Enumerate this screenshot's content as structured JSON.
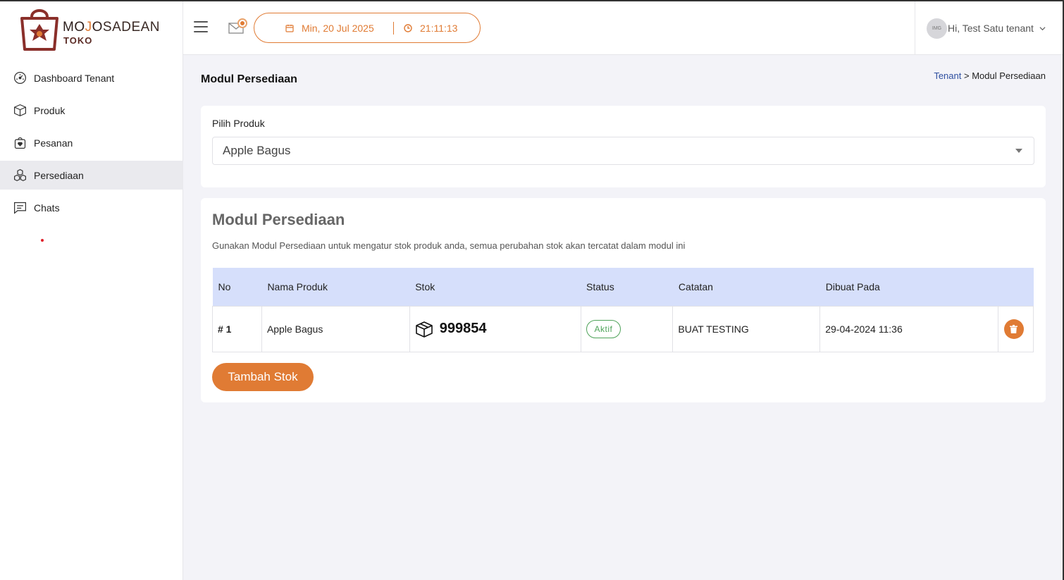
{
  "brand": {
    "title_part1": "MO",
    "title_part2": "J",
    "title_part3": "O",
    "title_part4": "SADEAN",
    "subtitle": "TOKO"
  },
  "sidebar": {
    "items": [
      {
        "label": "Dashboard Tenant",
        "icon": "gauge-icon"
      },
      {
        "label": "Produk",
        "icon": "box-icon"
      },
      {
        "label": "Pesanan",
        "icon": "shopping-bag-icon"
      },
      {
        "label": "Persediaan",
        "icon": "boxes-icon",
        "active": true
      },
      {
        "label": "Chats",
        "icon": "chat-icon"
      }
    ]
  },
  "header": {
    "date": "Min, 20 Jul 2025",
    "time": "21:11:13",
    "user_greeting": "Hi, Test Satu tenant",
    "avatar_text": "IMG"
  },
  "page": {
    "title": "Modul Persediaan",
    "breadcrumb_link": "Tenant",
    "breadcrumb_sep": ">",
    "breadcrumb_current": "Modul Persediaan"
  },
  "product_select": {
    "label": "Pilih Produk",
    "value": "Apple Bagus"
  },
  "inventory": {
    "title": "Modul Persediaan",
    "description": "Gunakan Modul Persediaan untuk mengatur stok produk anda, semua perubahan stok akan tercatat dalam modul ini",
    "columns": [
      "No",
      "Nama Produk",
      "Stok",
      "Status",
      "Catatan",
      "Dibuat Pada"
    ],
    "rows": [
      {
        "no": "# 1",
        "name": "Apple Bagus",
        "stock": "999854",
        "status": "Aktif",
        "note": "BUAT TESTING",
        "created": "29-04-2024 11:36"
      }
    ],
    "add_button": "Tambah Stok"
  },
  "colors": {
    "accent": "#e07b34",
    "table_header": "#d6dffb",
    "status_green": "#4fa35a"
  }
}
